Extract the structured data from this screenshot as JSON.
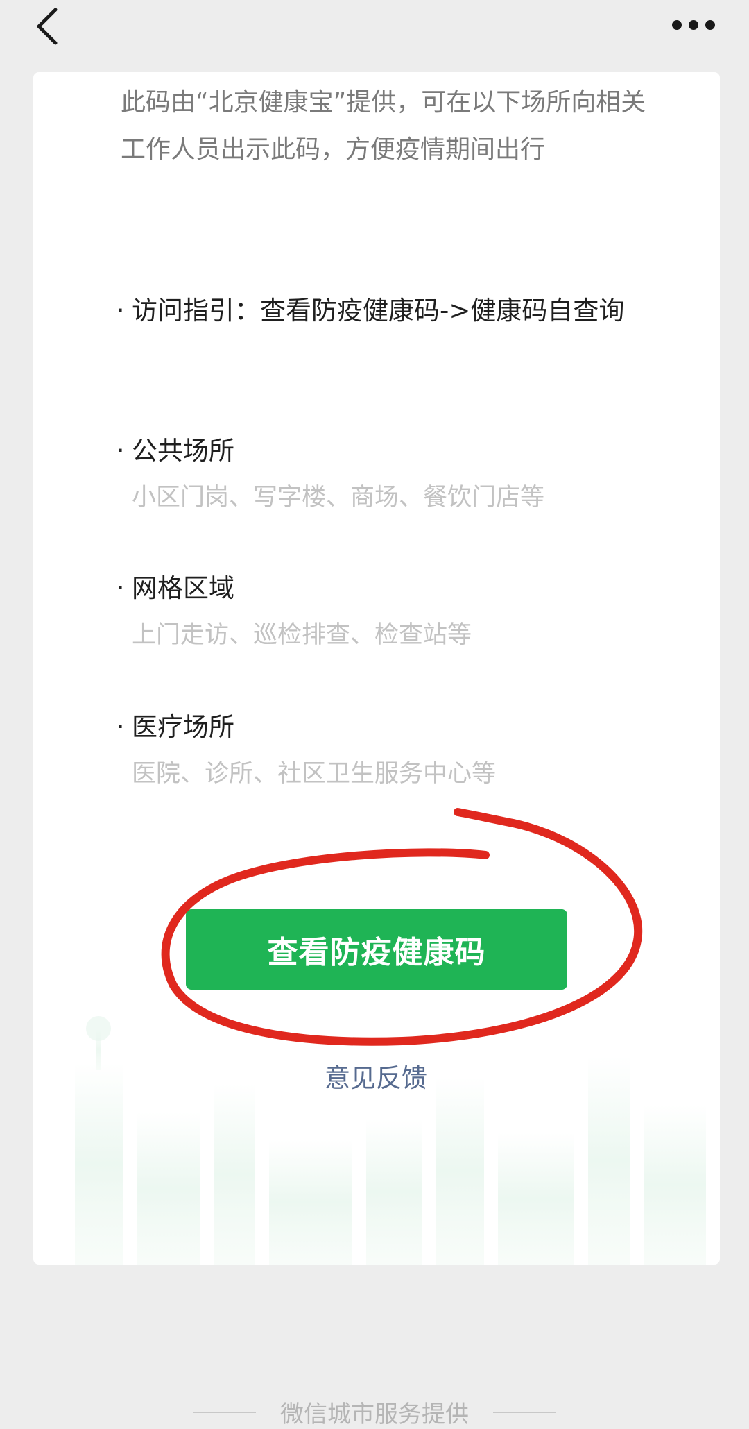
{
  "nav": {
    "back_icon": "chevron-left-icon",
    "more_icon": "more-dots-icon"
  },
  "intro": {
    "text": "此码由“北京健康宝”提供，可在以下场所向相关工作人员出示此码，方便疫情期间出行"
  },
  "sections": [
    {
      "bullet": "·",
      "title": "访问指引：查看防疫健康码->健康码自查询",
      "desc": ""
    },
    {
      "bullet": "·",
      "title": "公共场所",
      "desc": "小区门岗、写字楼、商场、餐饮门店等"
    },
    {
      "bullet": "·",
      "title": "网格区域",
      "desc": "上门走访、巡检排查、检查站等"
    },
    {
      "bullet": "·",
      "title": "医疗场所",
      "desc": "医院、诊所、社区卫生服务中心等"
    }
  ],
  "actions": {
    "primary_label": "查看防疫健康码",
    "feedback_label": "意见反馈"
  },
  "footer": {
    "text": "微信城市服务提供"
  },
  "colors": {
    "primary_green": "#1fb455",
    "link_blue": "#566a8f",
    "annotation_red": "#e0281e"
  }
}
